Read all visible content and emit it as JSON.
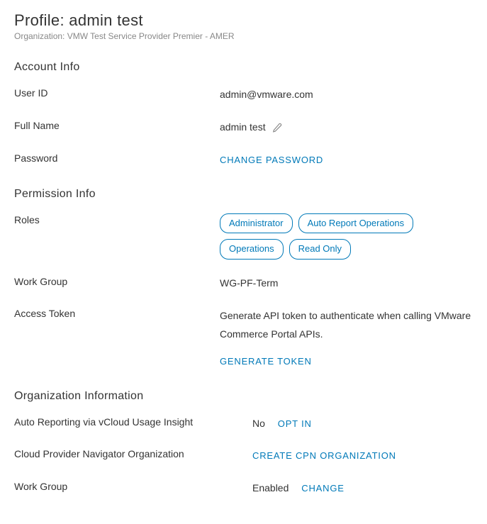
{
  "header": {
    "title": "Profile: admin test",
    "org_prefix": "Organization: ",
    "org_name": "VMW Test Service Provider Premier - AMER"
  },
  "sections": {
    "account": "Account Info",
    "permission": "Permission Info",
    "org": "Organization Information"
  },
  "account": {
    "user_id_label": "User ID",
    "user_id_value": "admin@vmware.com",
    "full_name_label": "Full Name",
    "full_name_value": "admin test",
    "password_label": "Password",
    "change_password_btn": "CHANGE PASSWORD"
  },
  "permission": {
    "roles_label": "Roles",
    "roles": [
      "Administrator",
      "Auto Report Operations",
      "Operations",
      "Read Only"
    ],
    "work_group_label": "Work Group",
    "work_group_value": "WG-PF-Term",
    "access_token_label": "Access Token",
    "access_token_desc": "Generate API token to authenticate when calling VMware Commerce Portal APIs.",
    "generate_token_btn": "GENERATE TOKEN"
  },
  "org": {
    "auto_report_label": "Auto Reporting via vCloud Usage Insight",
    "auto_report_value": "No",
    "opt_in_btn": "OPT IN",
    "cpn_label": "Cloud Provider Navigator Organization",
    "cpn_btn": "CREATE CPN ORGANIZATION",
    "wg_label": "Work Group",
    "wg_value": "Enabled",
    "change_btn": "CHANGE"
  }
}
